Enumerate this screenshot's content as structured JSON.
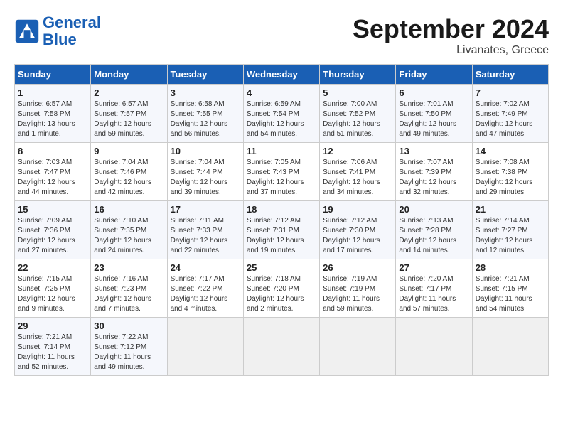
{
  "header": {
    "logo_line1": "General",
    "logo_line2": "Blue",
    "month": "September 2024",
    "location": "Livanates, Greece"
  },
  "columns": [
    "Sunday",
    "Monday",
    "Tuesday",
    "Wednesday",
    "Thursday",
    "Friday",
    "Saturday"
  ],
  "weeks": [
    [
      {
        "day": "1",
        "info": "Sunrise: 6:57 AM\nSunset: 7:58 PM\nDaylight: 13 hours\nand 1 minute."
      },
      {
        "day": "2",
        "info": "Sunrise: 6:57 AM\nSunset: 7:57 PM\nDaylight: 12 hours\nand 59 minutes."
      },
      {
        "day": "3",
        "info": "Sunrise: 6:58 AM\nSunset: 7:55 PM\nDaylight: 12 hours\nand 56 minutes."
      },
      {
        "day": "4",
        "info": "Sunrise: 6:59 AM\nSunset: 7:54 PM\nDaylight: 12 hours\nand 54 minutes."
      },
      {
        "day": "5",
        "info": "Sunrise: 7:00 AM\nSunset: 7:52 PM\nDaylight: 12 hours\nand 51 minutes."
      },
      {
        "day": "6",
        "info": "Sunrise: 7:01 AM\nSunset: 7:50 PM\nDaylight: 12 hours\nand 49 minutes."
      },
      {
        "day": "7",
        "info": "Sunrise: 7:02 AM\nSunset: 7:49 PM\nDaylight: 12 hours\nand 47 minutes."
      }
    ],
    [
      {
        "day": "8",
        "info": "Sunrise: 7:03 AM\nSunset: 7:47 PM\nDaylight: 12 hours\nand 44 minutes."
      },
      {
        "day": "9",
        "info": "Sunrise: 7:04 AM\nSunset: 7:46 PM\nDaylight: 12 hours\nand 42 minutes."
      },
      {
        "day": "10",
        "info": "Sunrise: 7:04 AM\nSunset: 7:44 PM\nDaylight: 12 hours\nand 39 minutes."
      },
      {
        "day": "11",
        "info": "Sunrise: 7:05 AM\nSunset: 7:43 PM\nDaylight: 12 hours\nand 37 minutes."
      },
      {
        "day": "12",
        "info": "Sunrise: 7:06 AM\nSunset: 7:41 PM\nDaylight: 12 hours\nand 34 minutes."
      },
      {
        "day": "13",
        "info": "Sunrise: 7:07 AM\nSunset: 7:39 PM\nDaylight: 12 hours\nand 32 minutes."
      },
      {
        "day": "14",
        "info": "Sunrise: 7:08 AM\nSunset: 7:38 PM\nDaylight: 12 hours\nand 29 minutes."
      }
    ],
    [
      {
        "day": "15",
        "info": "Sunrise: 7:09 AM\nSunset: 7:36 PM\nDaylight: 12 hours\nand 27 minutes."
      },
      {
        "day": "16",
        "info": "Sunrise: 7:10 AM\nSunset: 7:35 PM\nDaylight: 12 hours\nand 24 minutes."
      },
      {
        "day": "17",
        "info": "Sunrise: 7:11 AM\nSunset: 7:33 PM\nDaylight: 12 hours\nand 22 minutes."
      },
      {
        "day": "18",
        "info": "Sunrise: 7:12 AM\nSunset: 7:31 PM\nDaylight: 12 hours\nand 19 minutes."
      },
      {
        "day": "19",
        "info": "Sunrise: 7:12 AM\nSunset: 7:30 PM\nDaylight: 12 hours\nand 17 minutes."
      },
      {
        "day": "20",
        "info": "Sunrise: 7:13 AM\nSunset: 7:28 PM\nDaylight: 12 hours\nand 14 minutes."
      },
      {
        "day": "21",
        "info": "Sunrise: 7:14 AM\nSunset: 7:27 PM\nDaylight: 12 hours\nand 12 minutes."
      }
    ],
    [
      {
        "day": "22",
        "info": "Sunrise: 7:15 AM\nSunset: 7:25 PM\nDaylight: 12 hours\nand 9 minutes."
      },
      {
        "day": "23",
        "info": "Sunrise: 7:16 AM\nSunset: 7:23 PM\nDaylight: 12 hours\nand 7 minutes."
      },
      {
        "day": "24",
        "info": "Sunrise: 7:17 AM\nSunset: 7:22 PM\nDaylight: 12 hours\nand 4 minutes."
      },
      {
        "day": "25",
        "info": "Sunrise: 7:18 AM\nSunset: 7:20 PM\nDaylight: 12 hours\nand 2 minutes."
      },
      {
        "day": "26",
        "info": "Sunrise: 7:19 AM\nSunset: 7:19 PM\nDaylight: 11 hours\nand 59 minutes."
      },
      {
        "day": "27",
        "info": "Sunrise: 7:20 AM\nSunset: 7:17 PM\nDaylight: 11 hours\nand 57 minutes."
      },
      {
        "day": "28",
        "info": "Sunrise: 7:21 AM\nSunset: 7:15 PM\nDaylight: 11 hours\nand 54 minutes."
      }
    ],
    [
      {
        "day": "29",
        "info": "Sunrise: 7:21 AM\nSunset: 7:14 PM\nDaylight: 11 hours\nand 52 minutes."
      },
      {
        "day": "30",
        "info": "Sunrise: 7:22 AM\nSunset: 7:12 PM\nDaylight: 11 hours\nand 49 minutes."
      },
      {
        "day": "",
        "info": ""
      },
      {
        "day": "",
        "info": ""
      },
      {
        "day": "",
        "info": ""
      },
      {
        "day": "",
        "info": ""
      },
      {
        "day": "",
        "info": ""
      }
    ]
  ]
}
